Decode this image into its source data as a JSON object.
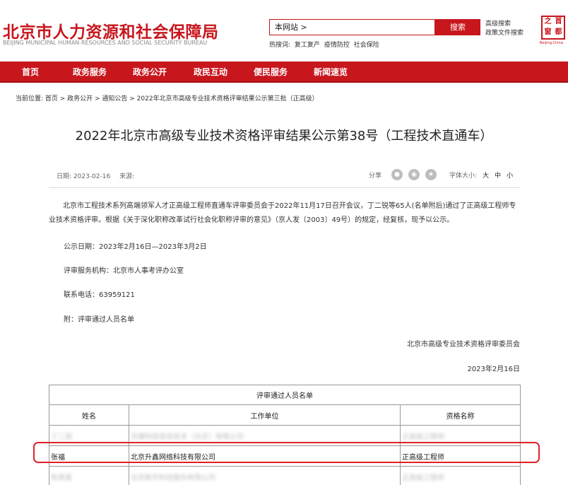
{
  "header": {
    "logo_cn": "北京市人力资源和社会保障局",
    "logo_en": "BEIJING MUNICIPAL HUMAN RESOURCES AND SOCIAL SECURITY BUREAU",
    "search_value": "本网站 >",
    "search_button": "搜索",
    "hot_label": "热搜词:",
    "hot_words": [
      "复工复产",
      "疫情防控",
      "社会保险"
    ],
    "advanced_search": "高级搜索",
    "policy_search": "政策文件搜索",
    "seal_chars": [
      "之",
      "首",
      "窗",
      "都"
    ],
    "seal_sub": "Beijing·China"
  },
  "nav": {
    "items": [
      "首页",
      "政务服务",
      "政务公开",
      "政民互动",
      "便民服务",
      "新闻速览"
    ]
  },
  "breadcrumb": "当前位置: 首页 > 政务公开 > 通知公告 > 2022年北京市高级专业技术资格评审结果公示第三批（正高级）",
  "article": {
    "title": "2022年北京市高级专业技术资格评审结果公示第38号（工程技术直通车）",
    "date_label": "日期:",
    "date": "2023-02-16",
    "source_label": "来源:",
    "share_label": "分享",
    "fontsize_label": "字体大小:",
    "fontsize_options": [
      "大",
      "中",
      "小"
    ],
    "intro": "北京市工程技术系列高端领军人才正高级工程师直通车评审委员会于2022年11月17日召开会议，丁二锐等65人(名单附后)通过了正高级工程师专业技术资格评审。根据《关于深化职称改革试行社会化职称评审的意见》（京人发〔2003〕49号）的规定，经复核，现予以公示。",
    "publicity_period": "公示日期：2023年2月16日—2023年3月2日",
    "service_org": "评审服务机构：北京市人事考评办公室",
    "phone": "联系电话：63959121",
    "attachment": "附：评审通过人员名单",
    "sign_org": "北京市高级专业技术资格评审委员会",
    "sign_date": "2023年2月16日"
  },
  "table": {
    "caption": "评审通过人员名单",
    "headers": [
      "姓名",
      "工作单位",
      "资格名称"
    ],
    "rows": [
      [
        "丁二锐",
        "京健科技高效技术（北京）有限公司",
        "正高级工程师"
      ],
      [
        "张福",
        "北京升鑫网络科技有限公司",
        "正高级工程师"
      ],
      [
        "陈英英",
        "北京数字科技股份有限公司",
        "正高级工程师"
      ]
    ]
  },
  "colors": {
    "brand_red": "#c8161d",
    "highlight_red": "#e0202a"
  }
}
